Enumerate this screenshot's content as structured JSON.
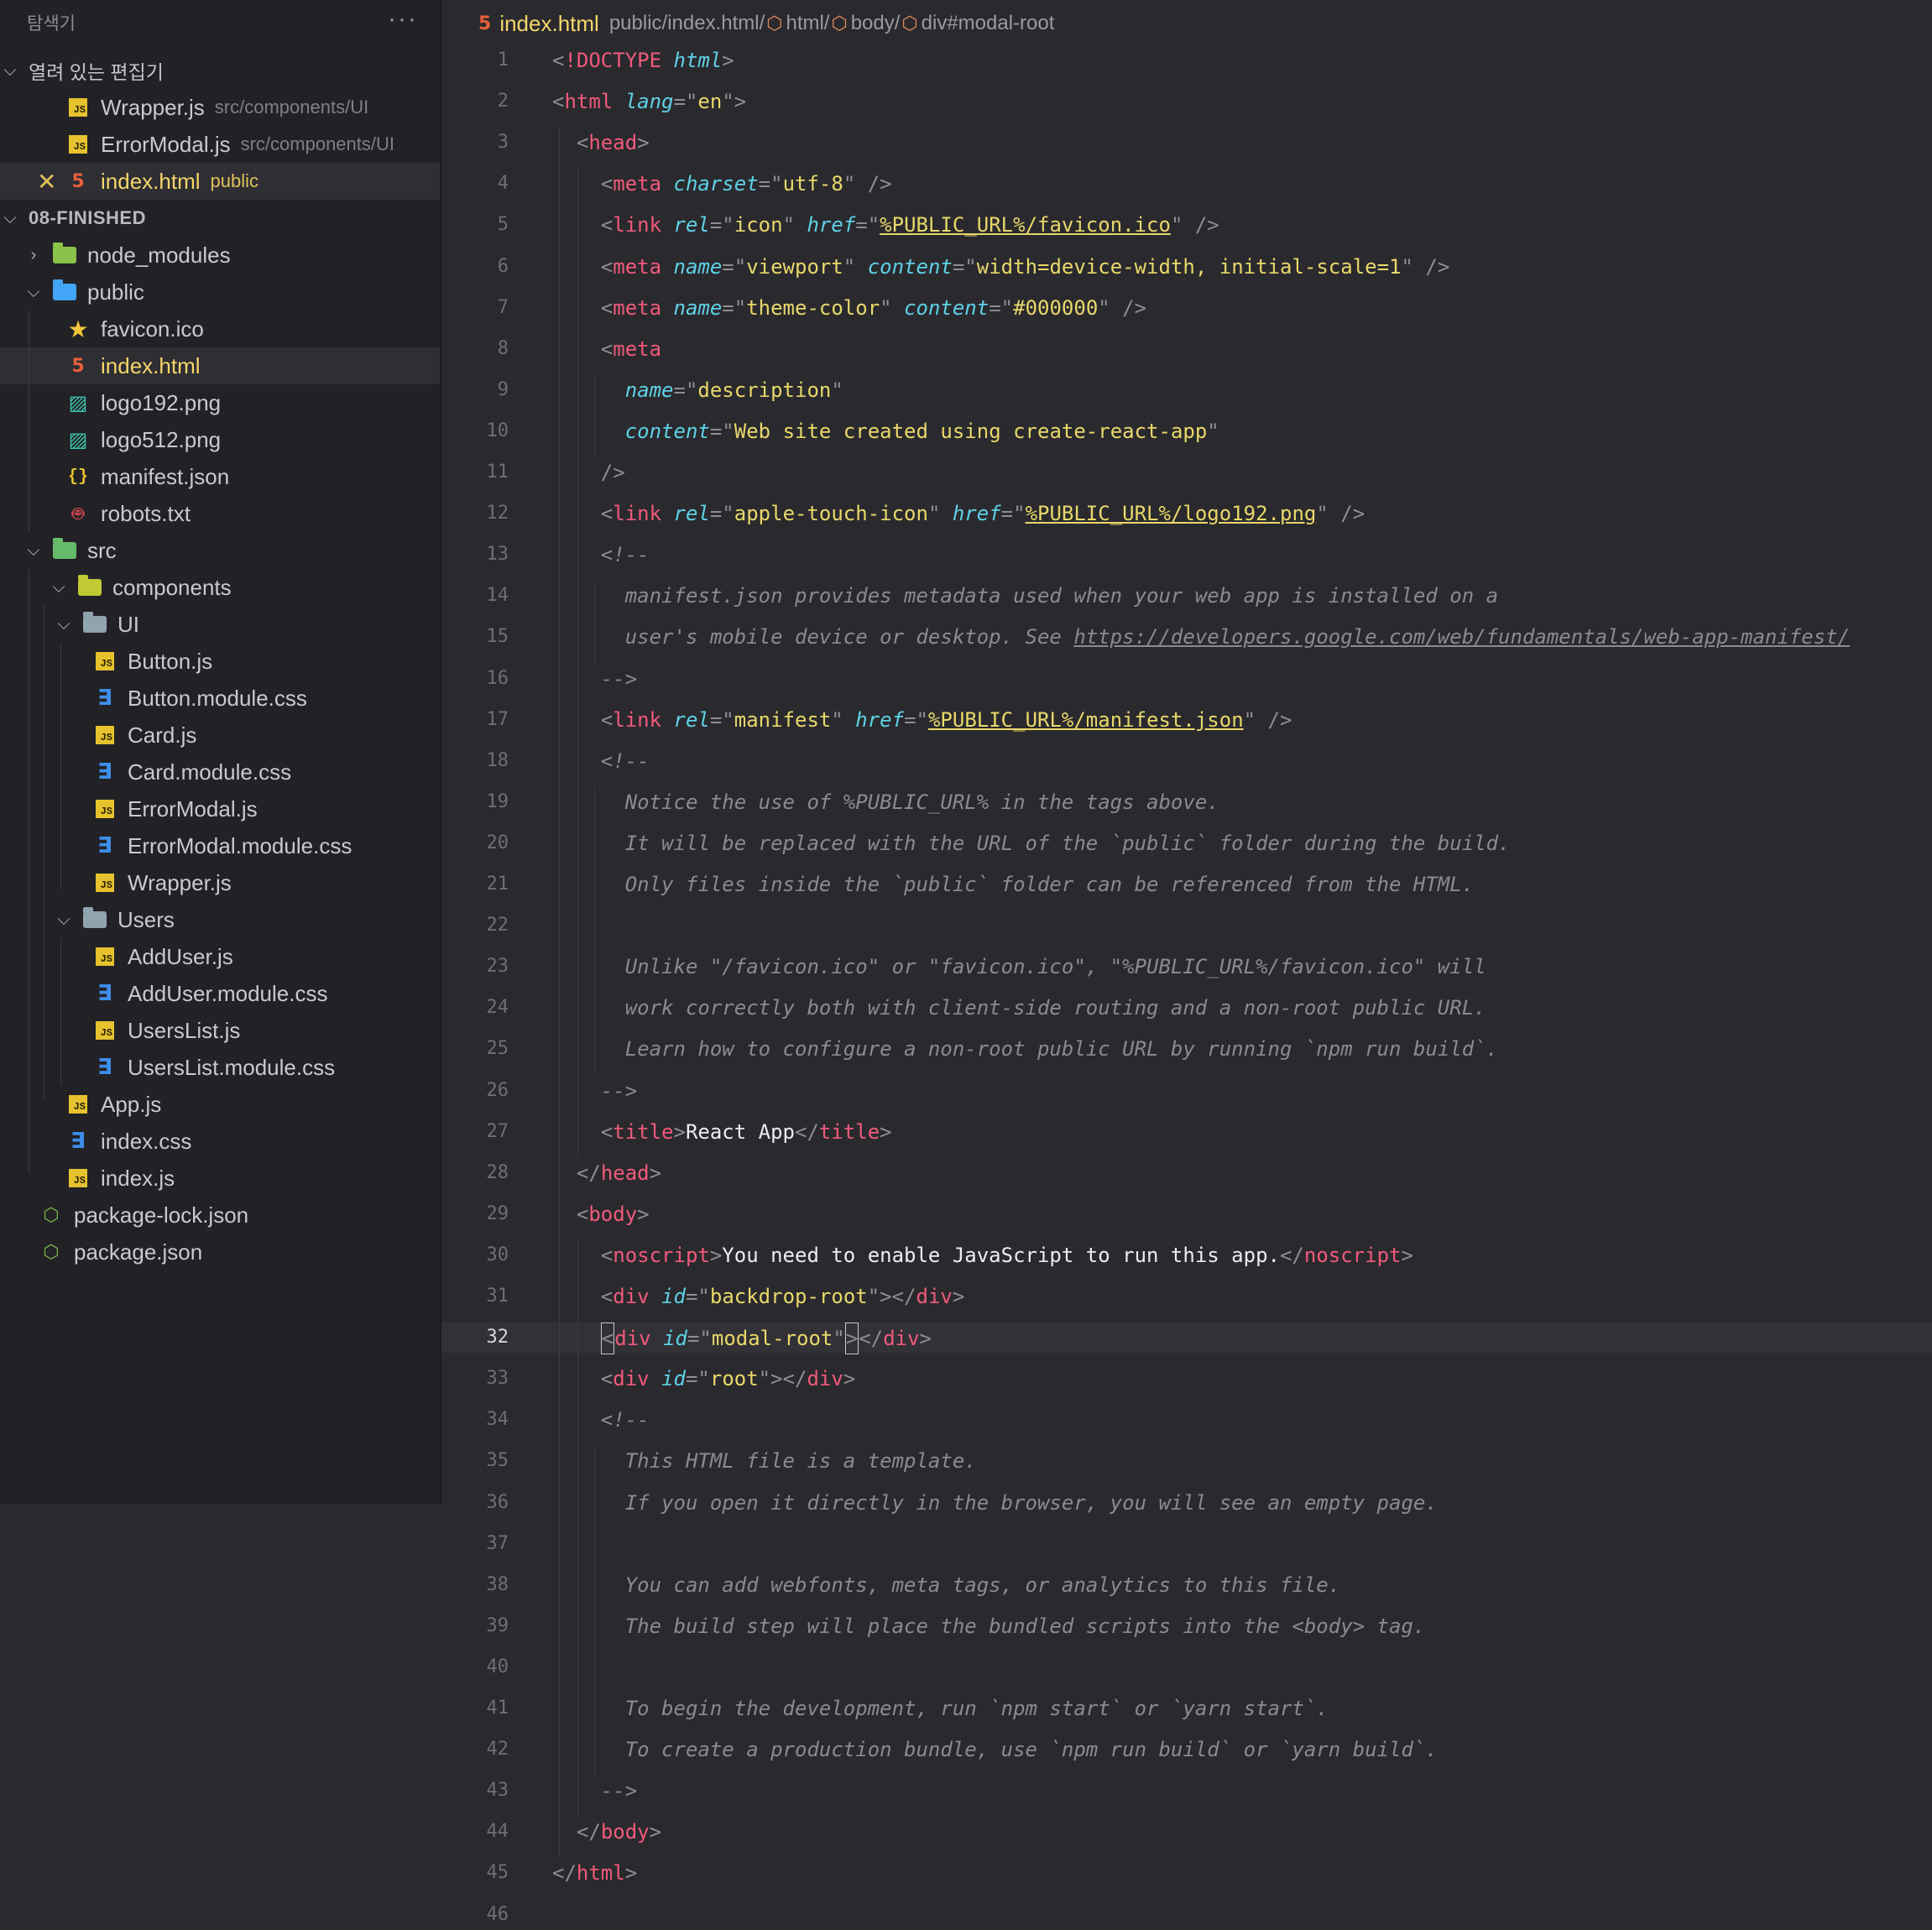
{
  "sidebar": {
    "title": "탐색기",
    "more": "···",
    "open_editors_label": "열려 있는 편집기",
    "project_label": "08-FINISHED",
    "open_editors": [
      {
        "name": "Wrapper.js",
        "desc": "src/components/UI",
        "icon": "js"
      },
      {
        "name": "ErrorModal.js",
        "desc": "src/components/UI",
        "icon": "js"
      },
      {
        "name": "index.html",
        "desc": "public",
        "icon": "html"
      }
    ],
    "tree": [
      {
        "name": "node_modules",
        "type": "folder",
        "icon": "folder-node"
      },
      {
        "name": "public",
        "type": "folder",
        "icon": "folder-public"
      },
      {
        "name": "favicon.ico",
        "type": "file",
        "icon": "star"
      },
      {
        "name": "index.html",
        "type": "file",
        "icon": "html"
      },
      {
        "name": "logo192.png",
        "type": "file",
        "icon": "image"
      },
      {
        "name": "logo512.png",
        "type": "file",
        "icon": "image"
      },
      {
        "name": "manifest.json",
        "type": "file",
        "icon": "json"
      },
      {
        "name": "robots.txt",
        "type": "file",
        "icon": "robot"
      },
      {
        "name": "src",
        "type": "folder",
        "icon": "folder-src"
      },
      {
        "name": "components",
        "type": "folder",
        "icon": "folder-components"
      },
      {
        "name": "UI",
        "type": "folder",
        "icon": "folder"
      },
      {
        "name": "Button.js",
        "type": "file",
        "icon": "js"
      },
      {
        "name": "Button.module.css",
        "type": "file",
        "icon": "css"
      },
      {
        "name": "Card.js",
        "type": "file",
        "icon": "js"
      },
      {
        "name": "Card.module.css",
        "type": "file",
        "icon": "css"
      },
      {
        "name": "ErrorModal.js",
        "type": "file",
        "icon": "js"
      },
      {
        "name": "ErrorModal.module.css",
        "type": "file",
        "icon": "css"
      },
      {
        "name": "Wrapper.js",
        "type": "file",
        "icon": "js"
      },
      {
        "name": "Users",
        "type": "folder",
        "icon": "folder"
      },
      {
        "name": "AddUser.js",
        "type": "file",
        "icon": "js"
      },
      {
        "name": "AddUser.module.css",
        "type": "file",
        "icon": "css"
      },
      {
        "name": "UsersList.js",
        "type": "file",
        "icon": "js"
      },
      {
        "name": "UsersList.module.css",
        "type": "file",
        "icon": "css"
      },
      {
        "name": "App.js",
        "type": "file",
        "icon": "js"
      },
      {
        "name": "index.css",
        "type": "file",
        "icon": "css"
      },
      {
        "name": "index.js",
        "type": "file",
        "icon": "js"
      },
      {
        "name": "package-lock.json",
        "type": "file",
        "icon": "npm"
      },
      {
        "name": "package.json",
        "type": "file",
        "icon": "npm"
      }
    ]
  },
  "editor": {
    "tab_name": "index.html",
    "breadcrumb": {
      "path": "public/index.html/",
      "parts": [
        "html/",
        "body/",
        "div#modal-root"
      ]
    },
    "current_line": 32,
    "lines": [
      {
        "n": 1,
        "toks": [
          [
            "p",
            "<"
          ],
          [
            "d",
            "!DOCTYPE"
          ],
          [
            "w",
            " "
          ],
          [
            "a",
            "html"
          ],
          [
            "p",
            ">"
          ]
        ]
      },
      {
        "n": 2,
        "toks": [
          [
            "p",
            "<"
          ],
          [
            "t",
            "html"
          ],
          [
            "w",
            " "
          ],
          [
            "a",
            "lang"
          ],
          [
            "p",
            "=\""
          ],
          [
            "s",
            "en"
          ],
          [
            "p",
            "\">"
          ]
        ]
      },
      {
        "n": 3,
        "toks": [
          [
            "w",
            "  "
          ],
          [
            "p",
            "<"
          ],
          [
            "t",
            "head"
          ],
          [
            "p",
            ">"
          ]
        ]
      },
      {
        "n": 4,
        "toks": [
          [
            "w",
            "    "
          ],
          [
            "p",
            "<"
          ],
          [
            "t",
            "meta"
          ],
          [
            "w",
            " "
          ],
          [
            "a",
            "charset"
          ],
          [
            "p",
            "=\""
          ],
          [
            "s",
            "utf-8"
          ],
          [
            "p",
            "\" />"
          ]
        ]
      },
      {
        "n": 5,
        "toks": [
          [
            "w",
            "    "
          ],
          [
            "p",
            "<"
          ],
          [
            "t",
            "link"
          ],
          [
            "w",
            " "
          ],
          [
            "a",
            "rel"
          ],
          [
            "p",
            "=\""
          ],
          [
            "s",
            "icon"
          ],
          [
            "p",
            "\""
          ],
          [
            "w",
            " "
          ],
          [
            "a",
            "href"
          ],
          [
            "p",
            "=\""
          ],
          [
            "u",
            "%PUBLIC_URL%/favicon.ico"
          ],
          [
            "p",
            "\" />"
          ]
        ]
      },
      {
        "n": 6,
        "toks": [
          [
            "w",
            "    "
          ],
          [
            "p",
            "<"
          ],
          [
            "t",
            "meta"
          ],
          [
            "w",
            " "
          ],
          [
            "a",
            "name"
          ],
          [
            "p",
            "=\""
          ],
          [
            "s",
            "viewport"
          ],
          [
            "p",
            "\""
          ],
          [
            "w",
            " "
          ],
          [
            "a",
            "content"
          ],
          [
            "p",
            "=\""
          ],
          [
            "s",
            "width=device-width, initial-scale=1"
          ],
          [
            "p",
            "\" />"
          ]
        ]
      },
      {
        "n": 7,
        "toks": [
          [
            "w",
            "    "
          ],
          [
            "p",
            "<"
          ],
          [
            "t",
            "meta"
          ],
          [
            "w",
            " "
          ],
          [
            "a",
            "name"
          ],
          [
            "p",
            "=\""
          ],
          [
            "s",
            "theme-color"
          ],
          [
            "p",
            "\""
          ],
          [
            "w",
            " "
          ],
          [
            "a",
            "content"
          ],
          [
            "p",
            "=\""
          ],
          [
            "s",
            "#000000"
          ],
          [
            "p",
            "\" />"
          ]
        ]
      },
      {
        "n": 8,
        "toks": [
          [
            "w",
            "    "
          ],
          [
            "p",
            "<"
          ],
          [
            "t",
            "meta"
          ]
        ]
      },
      {
        "n": 9,
        "toks": [
          [
            "w",
            "      "
          ],
          [
            "a",
            "name"
          ],
          [
            "p",
            "=\""
          ],
          [
            "s",
            "description"
          ],
          [
            "p",
            "\""
          ]
        ]
      },
      {
        "n": 10,
        "toks": [
          [
            "w",
            "      "
          ],
          [
            "a",
            "content"
          ],
          [
            "p",
            "=\""
          ],
          [
            "s",
            "Web site created using create-react-app"
          ],
          [
            "p",
            "\""
          ]
        ]
      },
      {
        "n": 11,
        "toks": [
          [
            "w",
            "    "
          ],
          [
            "p",
            "/>"
          ]
        ]
      },
      {
        "n": 12,
        "toks": [
          [
            "w",
            "    "
          ],
          [
            "p",
            "<"
          ],
          [
            "t",
            "link"
          ],
          [
            "w",
            " "
          ],
          [
            "a",
            "rel"
          ],
          [
            "p",
            "=\""
          ],
          [
            "s",
            "apple-touch-icon"
          ],
          [
            "p",
            "\""
          ],
          [
            "w",
            " "
          ],
          [
            "a",
            "href"
          ],
          [
            "p",
            "=\""
          ],
          [
            "u",
            "%PUBLIC_URL%/logo192.png"
          ],
          [
            "p",
            "\" />"
          ]
        ]
      },
      {
        "n": 13,
        "toks": [
          [
            "w",
            "    "
          ],
          [
            "c",
            "<!--"
          ]
        ]
      },
      {
        "n": 14,
        "toks": [
          [
            "w",
            "      "
          ],
          [
            "c",
            "manifest.json provides metadata used when your web app is installed on a"
          ]
        ]
      },
      {
        "n": 15,
        "toks": [
          [
            "w",
            "      "
          ],
          [
            "c",
            "user's mobile device or desktop. See "
          ],
          [
            "cu",
            "https://developers.google.com/web/fundamentals/web-app-manifest/"
          ]
        ]
      },
      {
        "n": 16,
        "toks": [
          [
            "w",
            "    "
          ],
          [
            "c",
            "-->"
          ]
        ]
      },
      {
        "n": 17,
        "toks": [
          [
            "w",
            "    "
          ],
          [
            "p",
            "<"
          ],
          [
            "t",
            "link"
          ],
          [
            "w",
            " "
          ],
          [
            "a",
            "rel"
          ],
          [
            "p",
            "=\""
          ],
          [
            "s",
            "manifest"
          ],
          [
            "p",
            "\""
          ],
          [
            "w",
            " "
          ],
          [
            "a",
            "href"
          ],
          [
            "p",
            "=\""
          ],
          [
            "u",
            "%PUBLIC_URL%/manifest.json"
          ],
          [
            "p",
            "\" />"
          ]
        ]
      },
      {
        "n": 18,
        "toks": [
          [
            "w",
            "    "
          ],
          [
            "c",
            "<!--"
          ]
        ]
      },
      {
        "n": 19,
        "toks": [
          [
            "w",
            "      "
          ],
          [
            "c",
            "Notice the use of %PUBLIC_URL% in the tags above."
          ]
        ]
      },
      {
        "n": 20,
        "toks": [
          [
            "w",
            "      "
          ],
          [
            "c",
            "It will be replaced with the URL of the `public` folder during the build."
          ]
        ]
      },
      {
        "n": 21,
        "toks": [
          [
            "w",
            "      "
          ],
          [
            "c",
            "Only files inside the `public` folder can be referenced from the HTML."
          ]
        ]
      },
      {
        "n": 22,
        "toks": []
      },
      {
        "n": 23,
        "toks": [
          [
            "w",
            "      "
          ],
          [
            "c",
            "Unlike \"/favicon.ico\" or \"favicon.ico\", \"%PUBLIC_URL%/favicon.ico\" will"
          ]
        ]
      },
      {
        "n": 24,
        "toks": [
          [
            "w",
            "      "
          ],
          [
            "c",
            "work correctly both with client-side routing and a non-root public URL."
          ]
        ]
      },
      {
        "n": 25,
        "toks": [
          [
            "w",
            "      "
          ],
          [
            "c",
            "Learn how to configure a non-root public URL by running `npm run build`."
          ]
        ]
      },
      {
        "n": 26,
        "toks": [
          [
            "w",
            "    "
          ],
          [
            "c",
            "-->"
          ]
        ]
      },
      {
        "n": 27,
        "toks": [
          [
            "w",
            "    "
          ],
          [
            "p",
            "<"
          ],
          [
            "t",
            "title"
          ],
          [
            "p",
            ">"
          ],
          [
            "w",
            "React App"
          ],
          [
            "p",
            "</"
          ],
          [
            "t",
            "title"
          ],
          [
            "p",
            ">"
          ]
        ]
      },
      {
        "n": 28,
        "toks": [
          [
            "w",
            "  "
          ],
          [
            "p",
            "</"
          ],
          [
            "t",
            "head"
          ],
          [
            "p",
            ">"
          ]
        ]
      },
      {
        "n": 29,
        "toks": [
          [
            "w",
            "  "
          ],
          [
            "p",
            "<"
          ],
          [
            "t",
            "body"
          ],
          [
            "p",
            ">"
          ]
        ]
      },
      {
        "n": 30,
        "toks": [
          [
            "w",
            "    "
          ],
          [
            "p",
            "<"
          ],
          [
            "t",
            "noscript"
          ],
          [
            "p",
            ">"
          ],
          [
            "w",
            "You need to enable JavaScript to run this app."
          ],
          [
            "p",
            "</"
          ],
          [
            "t",
            "noscript"
          ],
          [
            "p",
            ">"
          ]
        ]
      },
      {
        "n": 31,
        "toks": [
          [
            "w",
            "    "
          ],
          [
            "p",
            "<"
          ],
          [
            "t",
            "div"
          ],
          [
            "w",
            " "
          ],
          [
            "a",
            "id"
          ],
          [
            "p",
            "=\""
          ],
          [
            "s",
            "backdrop-root"
          ],
          [
            "p",
            "\"></"
          ],
          [
            "t",
            "div"
          ],
          [
            "p",
            ">"
          ]
        ]
      },
      {
        "n": 32,
        "toks": [
          [
            "w",
            "    "
          ],
          [
            "k",
            "<"
          ],
          [
            "t",
            "div"
          ],
          [
            "w",
            " "
          ],
          [
            "a",
            "id"
          ],
          [
            "p",
            "=\""
          ],
          [
            "s",
            "modal-root"
          ],
          [
            "p",
            "\""
          ],
          [
            "k",
            ">"
          ],
          [
            "p",
            "</"
          ],
          [
            "t",
            "div"
          ],
          [
            "p",
            ">"
          ]
        ]
      },
      {
        "n": 33,
        "toks": [
          [
            "w",
            "    "
          ],
          [
            "p",
            "<"
          ],
          [
            "t",
            "div"
          ],
          [
            "w",
            " "
          ],
          [
            "a",
            "id"
          ],
          [
            "p",
            "=\""
          ],
          [
            "s",
            "root"
          ],
          [
            "p",
            "\"></"
          ],
          [
            "t",
            "div"
          ],
          [
            "p",
            ">"
          ]
        ]
      },
      {
        "n": 34,
        "toks": [
          [
            "w",
            "    "
          ],
          [
            "c",
            "<!--"
          ]
        ]
      },
      {
        "n": 35,
        "toks": [
          [
            "w",
            "      "
          ],
          [
            "c",
            "This HTML file is a template."
          ]
        ]
      },
      {
        "n": 36,
        "toks": [
          [
            "w",
            "      "
          ],
          [
            "c",
            "If you open it directly in the browser, you will see an empty page."
          ]
        ]
      },
      {
        "n": 37,
        "toks": []
      },
      {
        "n": 38,
        "toks": [
          [
            "w",
            "      "
          ],
          [
            "c",
            "You can add webfonts, meta tags, or analytics to this file."
          ]
        ]
      },
      {
        "n": 39,
        "toks": [
          [
            "w",
            "      "
          ],
          [
            "c",
            "The build step will place the bundled scripts into the <body> tag."
          ]
        ]
      },
      {
        "n": 40,
        "toks": []
      },
      {
        "n": 41,
        "toks": [
          [
            "w",
            "      "
          ],
          [
            "c",
            "To begin the development, run `npm start` or `yarn start`."
          ]
        ]
      },
      {
        "n": 42,
        "toks": [
          [
            "w",
            "      "
          ],
          [
            "c",
            "To create a production bundle, use `npm run build` or `yarn build`."
          ]
        ]
      },
      {
        "n": 43,
        "toks": [
          [
            "w",
            "    "
          ],
          [
            "c",
            "-->"
          ]
        ]
      },
      {
        "n": 44,
        "toks": [
          [
            "w",
            "  "
          ],
          [
            "p",
            "</"
          ],
          [
            "t",
            "body"
          ],
          [
            "p",
            ">"
          ]
        ]
      },
      {
        "n": 45,
        "toks": [
          [
            "p",
            "</"
          ],
          [
            "t",
            "html"
          ],
          [
            "p",
            ">"
          ]
        ]
      },
      {
        "n": 46,
        "toks": []
      }
    ]
  }
}
